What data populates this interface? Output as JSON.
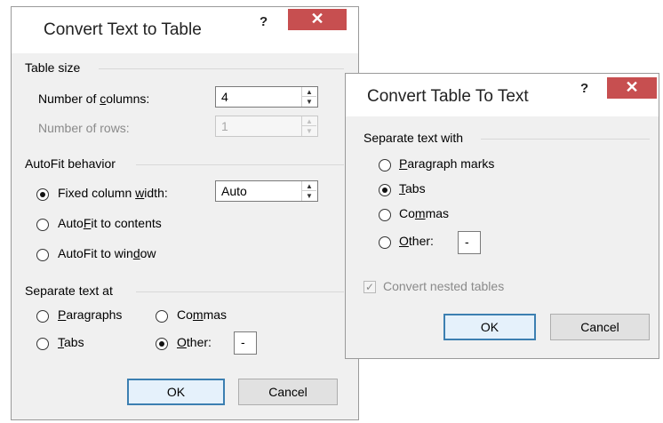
{
  "left_dialog": {
    "title": "Convert Text to Table",
    "help": "?",
    "close": "✕",
    "table_size": {
      "label": "Table size",
      "columns_label_pre": "Number of ",
      "columns_label_u": "c",
      "columns_label_post": "olumns:",
      "columns_value": "4",
      "rows_label": "Number of rows:",
      "rows_value": "1"
    },
    "autofit": {
      "label": "AutoFit behavior",
      "fixed_pre": "Fixed column ",
      "fixed_u": "w",
      "fixed_post": "idth:",
      "fixed_value": "Auto",
      "contents_pre": "Auto",
      "contents_u": "F",
      "contents_post": "it to contents",
      "window_pre": "AutoFit to win",
      "window_u": "d",
      "window_post": "ow"
    },
    "separate": {
      "label": "Separate text at",
      "paragraphs_u": "P",
      "paragraphs_post": "aragraphs",
      "commas_pre": "Co",
      "commas_u": "m",
      "commas_post": "mas",
      "tabs_u": "T",
      "tabs_post": "abs",
      "other_u": "O",
      "other_post": "ther:",
      "other_value": "-"
    },
    "ok": "OK",
    "cancel": "Cancel"
  },
  "right_dialog": {
    "title": "Convert Table To Text",
    "help": "?",
    "close": "✕",
    "separate": {
      "label": "Separate text with",
      "paragraph_u": "P",
      "paragraph_post": "aragraph marks",
      "tabs_u": "T",
      "tabs_post": "abs",
      "commas_pre": "Co",
      "commas_u": "m",
      "commas_post": "mas",
      "other_u": "O",
      "other_post": "ther:",
      "other_value": "-"
    },
    "nested_label": "Convert nested tables",
    "ok": "OK",
    "cancel": "Cancel"
  }
}
